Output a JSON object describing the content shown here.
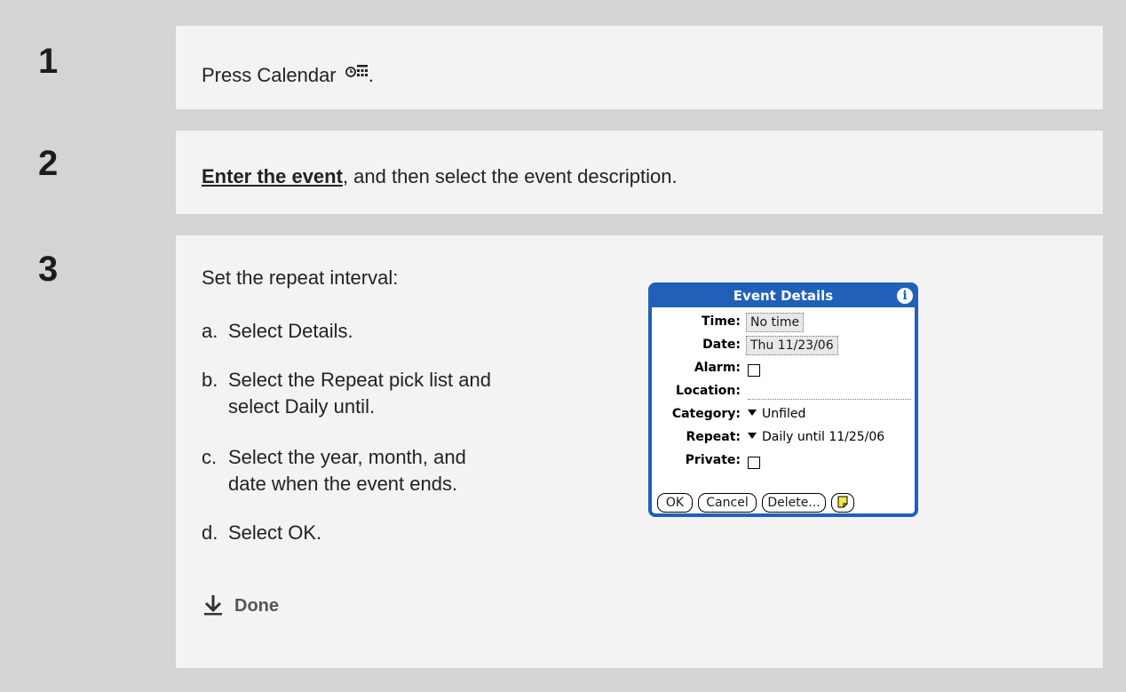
{
  "steps": [
    {
      "number": "1",
      "text_before": "Press Calendar",
      "text_after": "."
    },
    {
      "number": "2",
      "link": "Enter the event",
      "text": ", and then select the event description."
    },
    {
      "number": "3",
      "intro": "Set the repeat interval:",
      "substeps": [
        {
          "label": "a.",
          "text": "Select Details."
        },
        {
          "label": "b.",
          "line1": "Select the Repeat pick list and",
          "line2": "select Daily until."
        },
        {
          "label": "c.",
          "line1": "Select the year, month, and",
          "line2": "date when the event ends."
        },
        {
          "label": "d.",
          "text": "Select OK."
        }
      ],
      "done": "Done"
    }
  ],
  "dialog": {
    "title": "Event Details",
    "info": "i",
    "time_label": "Time:",
    "time_value": "No time",
    "date_label": "Date:",
    "date_value": "Thu 11/23/06",
    "alarm_label": "Alarm:",
    "location_label": "Location:",
    "category_label": "Category:",
    "category_value": "Unfiled",
    "repeat_label": "Repeat:",
    "repeat_value": "Daily until 11/25/06",
    "private_label": "Private:",
    "buttons": {
      "ok": "OK",
      "cancel": "Cancel",
      "delete": "Delete..."
    }
  }
}
